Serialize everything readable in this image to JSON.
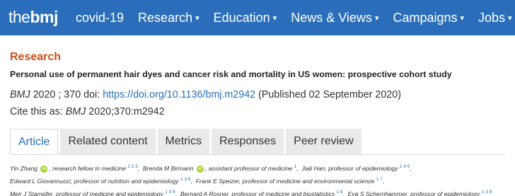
{
  "brand": {
    "logo_the": "the",
    "logo_bmj": "bmj"
  },
  "nav": {
    "items": [
      {
        "label": "covid-19",
        "has_dropdown": false
      },
      {
        "label": "Research",
        "has_dropdown": true
      },
      {
        "label": "Education",
        "has_dropdown": true
      },
      {
        "label": "News & Views",
        "has_dropdown": true
      },
      {
        "label": "Campaigns",
        "has_dropdown": true
      },
      {
        "label": "Jobs",
        "has_dropdown": true
      }
    ],
    "caret_glyph": "▾"
  },
  "article": {
    "section": "Research",
    "title": "Personal use of permanent hair dyes and cancer risk and mortality in US women: prospective cohort study",
    "journal": "BMJ",
    "year_volume": " 2020 ; 370",
    "doi_label": "doi:",
    "doi_url": "https://doi.org/10.1136/bmj.m2942",
    "published": "(Published 02 September 2020)",
    "cite_prefix": "Cite this as:",
    "cite_journal": "BMJ",
    "cite_ref": "2020;370:m2942"
  },
  "tabs": [
    {
      "label": "Article",
      "active": true
    },
    {
      "label": "Related content",
      "active": false
    },
    {
      "label": "Metrics",
      "active": false
    },
    {
      "label": "Responses",
      "active": false
    },
    {
      "label": "Peer review",
      "active": false
    }
  ],
  "authors": {
    "line1": [
      {
        "name": "Yin Zhang",
        "orcid": true,
        "role": ", research fellow in medicine",
        "aff": "1 2 3"
      },
      {
        "name": "Brenda M Birmann",
        "orcid": true,
        "role": ", assistant professor of medicine",
        "aff": "1"
      },
      {
        "name": "Jiali Han",
        "orcid": false,
        "role": ", professor of epidemiology",
        "aff": "1 4 5"
      }
    ],
    "line2": [
      {
        "name": "Edward L Giovannucci",
        "orcid": false,
        "role": ", professor of nutrition and epidemiology",
        "aff": "1 3 6"
      },
      {
        "name": "Frank E Speizer",
        "orcid": false,
        "role": ", professor of medicine and environmental science",
        "aff": "1 7"
      }
    ],
    "line3": [
      {
        "name": "Meir J Stampfer",
        "orcid": false,
        "role": ", professor of medicine and epidemiology",
        "aff": "1 3 6"
      },
      {
        "name": "Bernard A Rosner",
        "orcid": false,
        "role": ", professor of medicine and biostatistics",
        "aff": "1 8"
      },
      {
        "name": "Eva S Schernhammer",
        "orcid": false,
        "role": ", professor of epidemiology",
        "aff": "1 3 9"
      }
    ]
  },
  "colors": {
    "nav_bg": "#2a6ebb",
    "section_label": "#c8511b",
    "link": "#2a6ebb",
    "orcid": "#a6ce39"
  }
}
